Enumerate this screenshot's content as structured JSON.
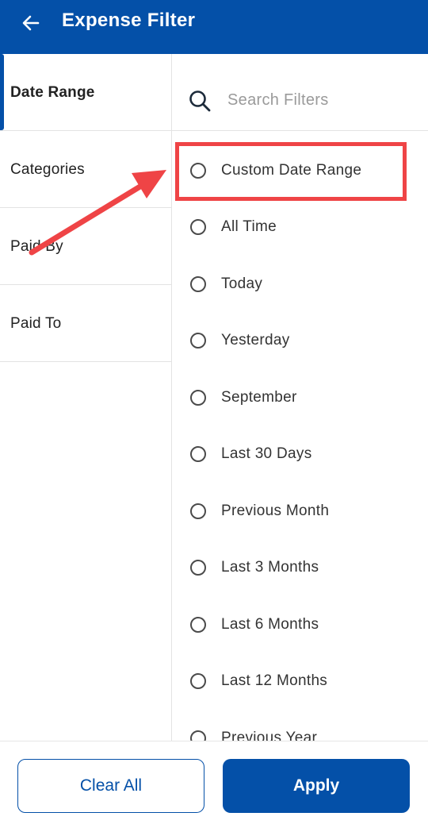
{
  "header": {
    "title": "Expense Filter",
    "back_icon": "arrow-left-icon"
  },
  "sidebar": {
    "items": [
      {
        "label": "Date Range",
        "active": true
      },
      {
        "label": "Categories",
        "active": false
      },
      {
        "label": "Paid By",
        "active": false
      },
      {
        "label": "Paid To",
        "active": false
      }
    ]
  },
  "search": {
    "placeholder": "Search Filters",
    "value": "",
    "icon": "search-icon"
  },
  "options": [
    {
      "label": "Custom Date Range"
    },
    {
      "label": "All Time"
    },
    {
      "label": "Today"
    },
    {
      "label": "Yesterday"
    },
    {
      "label": "September"
    },
    {
      "label": "Last 30 Days"
    },
    {
      "label": "Previous Month"
    },
    {
      "label": "Last 3 Months"
    },
    {
      "label": "Last 6 Months"
    },
    {
      "label": "Last 12 Months"
    },
    {
      "label": "Previous Year"
    }
  ],
  "footer": {
    "clear_label": "Clear All",
    "apply_label": "Apply"
  },
  "colors": {
    "primary": "#0450a8",
    "annotation": "#ef4446"
  }
}
